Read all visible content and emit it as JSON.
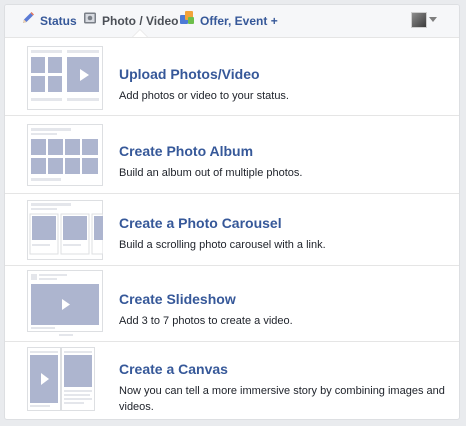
{
  "tabs": [
    {
      "label": "Status",
      "icon": "pencil-icon"
    },
    {
      "label": "Photo / Video",
      "icon": "camera-icon"
    },
    {
      "label": "Offer, Event +",
      "icon": "offer-event-icon"
    }
  ],
  "account": {
    "avatar_icon": "avatar-icon",
    "menu_icon": "chevron-down-icon"
  },
  "options": [
    {
      "title": "Upload Photos/Video",
      "description": "Add photos or video to your status."
    },
    {
      "title": "Create Photo Album",
      "description": "Build an album out of multiple photos."
    },
    {
      "title": "Create a Photo Carousel",
      "description": "Build a scrolling photo carousel with a link."
    },
    {
      "title": "Create Slideshow",
      "description": "Add 3 to 7 photos to create a video."
    },
    {
      "title": "Create a Canvas",
      "description": "Now you can tell a more immersive story by combining images and videos."
    }
  ],
  "colors": {
    "link": "#365899",
    "placeholder": "#adb5cf",
    "border": "#dddfe2"
  }
}
